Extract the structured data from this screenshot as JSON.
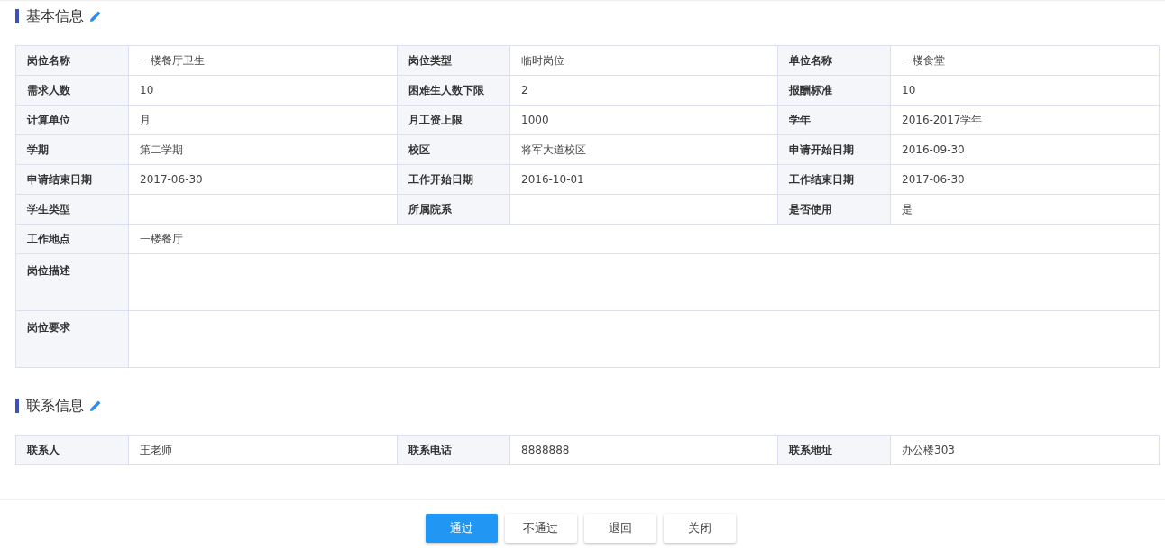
{
  "sections": [
    {
      "title": "基本信息",
      "rows": [
        [
          {
            "label": "岗位名称",
            "value": "一楼餐厅卫生"
          },
          {
            "label": "岗位类型",
            "value": "临时岗位"
          },
          {
            "label": "单位名称",
            "value": "一楼食堂"
          }
        ],
        [
          {
            "label": "需求人数",
            "value": "10"
          },
          {
            "label": "困难生人数下限",
            "value": "2"
          },
          {
            "label": "报酬标准",
            "value": "10"
          }
        ],
        [
          {
            "label": "计算单位",
            "value": "月"
          },
          {
            "label": "月工资上限",
            "value": "1000"
          },
          {
            "label": "学年",
            "value": "2016-2017学年"
          }
        ],
        [
          {
            "label": "学期",
            "value": "第二学期"
          },
          {
            "label": "校区",
            "value": "将军大道校区"
          },
          {
            "label": "申请开始日期",
            "value": "2016-09-30"
          }
        ],
        [
          {
            "label": "申请结束日期",
            "value": "2017-06-30"
          },
          {
            "label": "工作开始日期",
            "value": "2016-10-01"
          },
          {
            "label": "工作结束日期",
            "value": "2017-06-30"
          }
        ],
        [
          {
            "label": "学生类型"
          },
          {
            "label": "所属院系"
          },
          {
            "label": "是否使用",
            "value": "是"
          }
        ],
        [
          {
            "label": "工作地点",
            "value": "一楼餐厅",
            "kind": "wide"
          }
        ],
        [
          {
            "label": "岗位描述",
            "kind": "tall"
          }
        ],
        [
          {
            "label": "岗位要求",
            "kind": "tall"
          }
        ]
      ]
    },
    {
      "title": "联系信息",
      "rows": [
        [
          {
            "label": "联系人",
            "value": "王老师"
          },
          {
            "label": "联系电话",
            "value": "8888888"
          },
          {
            "label": "联系地址",
            "value": "办公楼303"
          }
        ]
      ]
    }
  ],
  "buttons": [
    {
      "label": "通过",
      "kind": "primary"
    },
    {
      "label": "不通过",
      "kind": "default"
    },
    {
      "label": "退回",
      "kind": "default"
    },
    {
      "label": "关闭",
      "kind": "default"
    }
  ]
}
